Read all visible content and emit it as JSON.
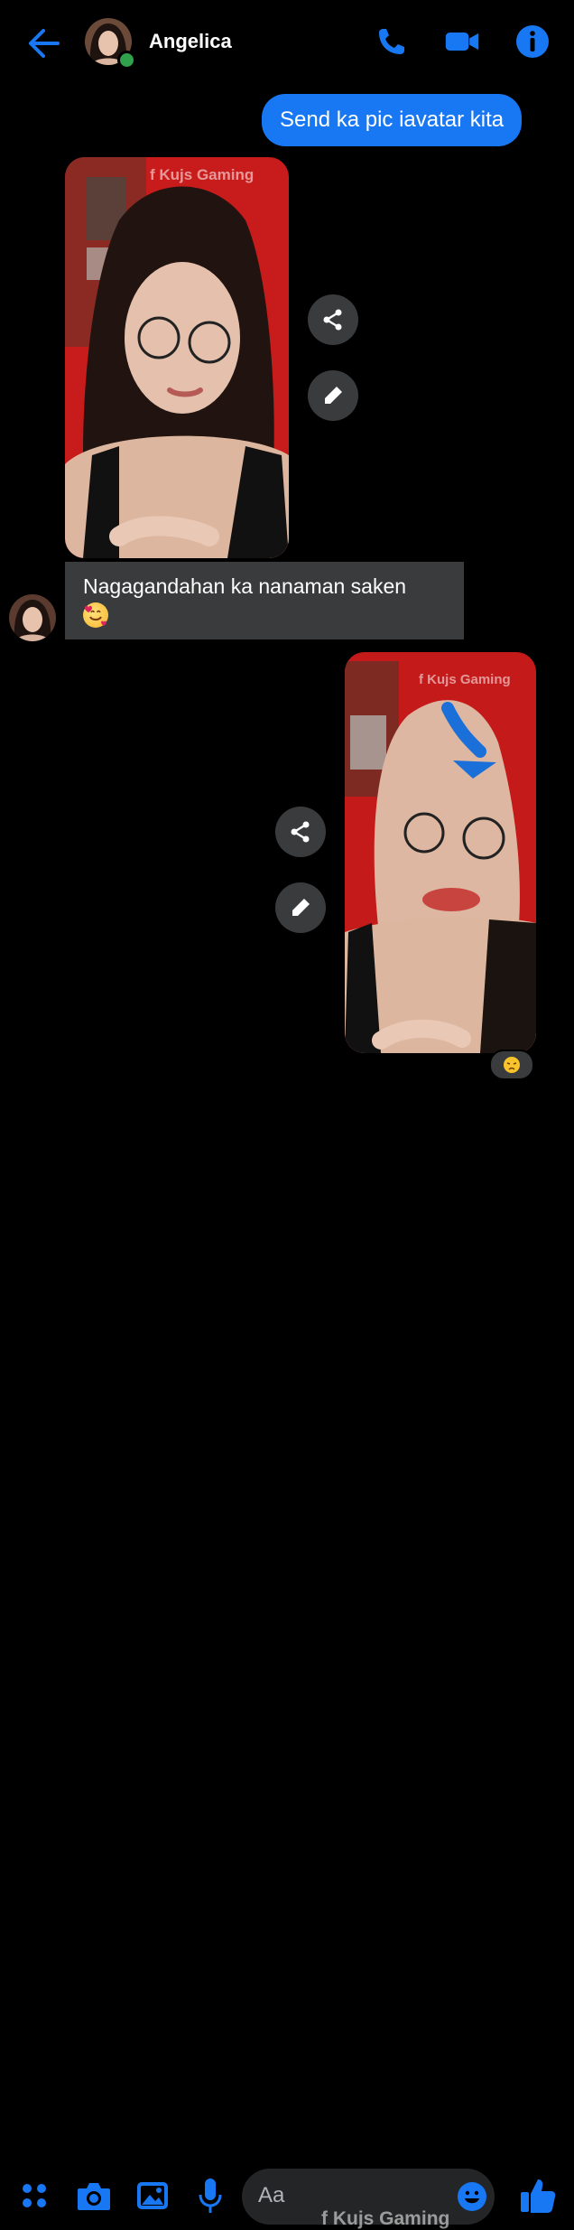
{
  "header": {
    "contact_name": "Angelica",
    "icons": [
      "back-arrow-icon",
      "phone-icon",
      "video-call-icon",
      "info-icon"
    ],
    "accent_color": "#1877f2",
    "online_color": "#31a24c"
  },
  "messages": {
    "outgoing_text": "Send ka pic iavatar kita",
    "incoming_text": "Nagagandahan ka nanaman saken",
    "incoming_emoji": "smiling-face-with-hearts",
    "reaction_emoji": "pensive-face"
  },
  "watermarks": {
    "photo1": "f Kujs Gaming",
    "photo2": "f Kujs Gaming",
    "footer": "f Kujs Gaming"
  },
  "composer": {
    "placeholder": "Aa",
    "icons": [
      "apps-grid-icon",
      "camera-icon",
      "gallery-icon",
      "microphone-icon",
      "emoji-icon",
      "like-thumb-icon"
    ]
  },
  "colors": {
    "background": "#000000",
    "bubble_outgoing": "#1877f2",
    "bubble_incoming": "#3a3b3c",
    "photo_red": "#d71e1e"
  }
}
